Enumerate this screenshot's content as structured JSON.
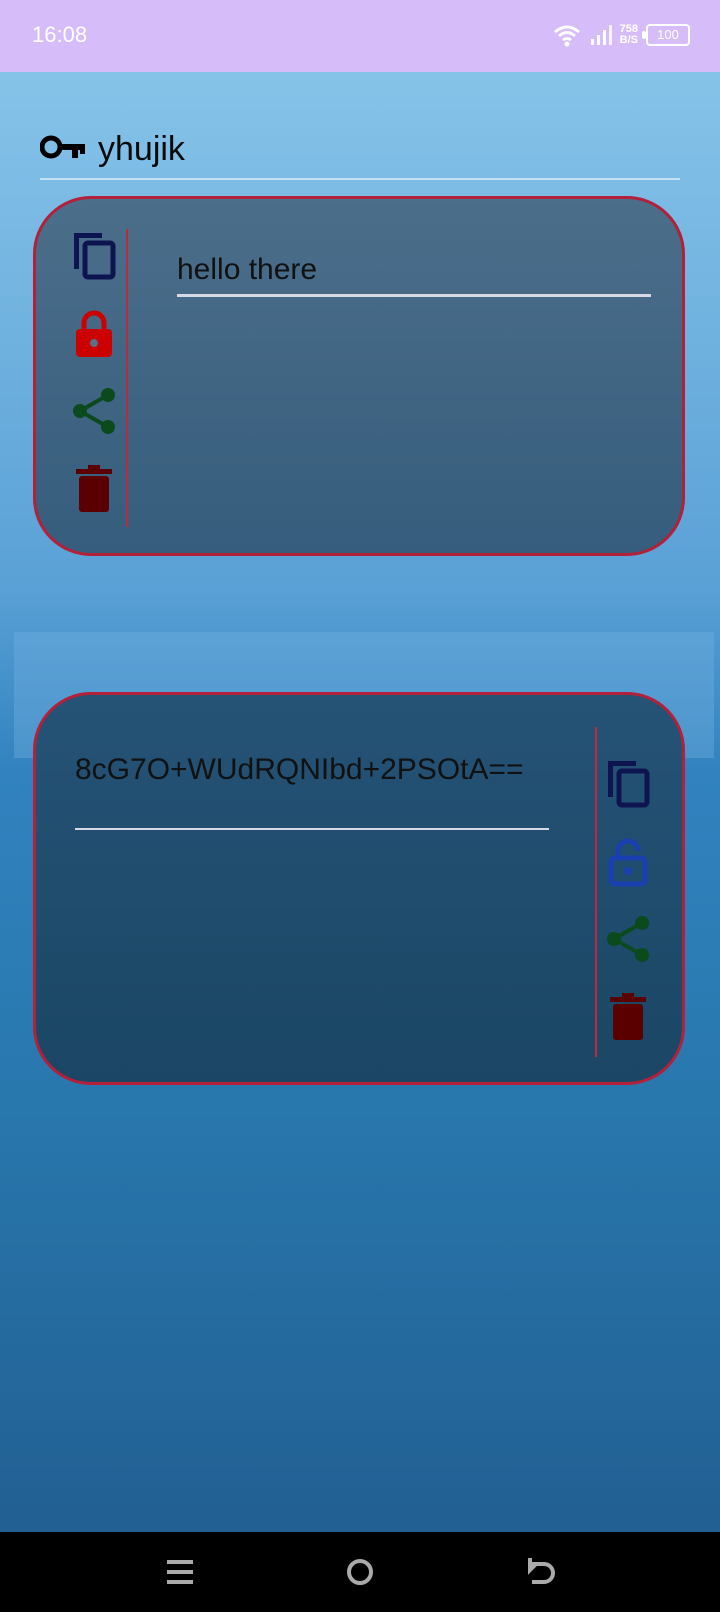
{
  "status_bar": {
    "time": "16:08",
    "speed_value": "758",
    "speed_unit": "B/S",
    "battery": "100"
  },
  "header": {
    "title": "yhujik",
    "icon": "key-icon"
  },
  "cards": [
    {
      "text": "hello there",
      "state": "locked",
      "actions": [
        "copy-icon",
        "lock-icon",
        "share-icon",
        "trash-icon"
      ]
    },
    {
      "text": "8cG7O+WUdRQNIbd+2PSOtA==",
      "state": "unlocked",
      "actions": [
        "copy-icon",
        "unlock-icon",
        "share-icon",
        "trash-icon"
      ]
    }
  ],
  "colors": {
    "card_border": "#b3203a",
    "copy_icon": "#0d1450",
    "lock_icon": "#cc0000",
    "unlock_icon": "#1a3fb0",
    "share_icon": "#0b4a1c",
    "trash_icon": "#5a0000"
  },
  "nav_bar": [
    "menu-icon",
    "home-icon",
    "back-icon"
  ]
}
